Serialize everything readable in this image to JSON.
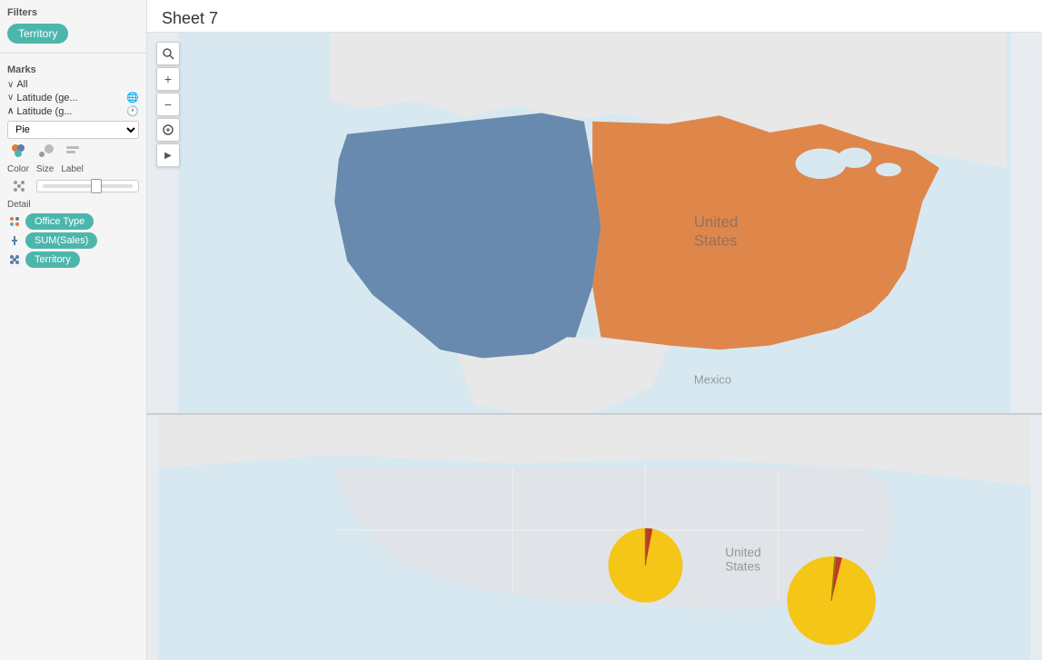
{
  "sidebar": {
    "filters_label": "Filters",
    "filter_pill": "Territory",
    "marks_label": "Marks",
    "all_label": "All",
    "latitude_gen": "Latitude (ge...",
    "latitude_g": "Latitude (g...",
    "pie_label": "Pie",
    "color_label": "Color",
    "size_label": "Size",
    "label_label": "Label",
    "detail_label": "Detail",
    "pill_office_type": "Office Type",
    "pill_sum_sales": "SUM(Sales)",
    "pill_territory": "Territory"
  },
  "sheet": {
    "title": "Sheet 7"
  },
  "map_controls": {
    "search": "🔍",
    "zoom_in": "+",
    "zoom_out": "−",
    "reset": "⊕",
    "play": "▶"
  },
  "colors": {
    "teal": "#4db6ac",
    "blue_region": "#5b7fa6",
    "orange_region": "#e07b39",
    "pie_yellow": "#f5c518",
    "pie_red": "#c0392b",
    "map_bg": "#dce6ec",
    "land": "#e8e8e8",
    "water": "#d0dce6"
  }
}
